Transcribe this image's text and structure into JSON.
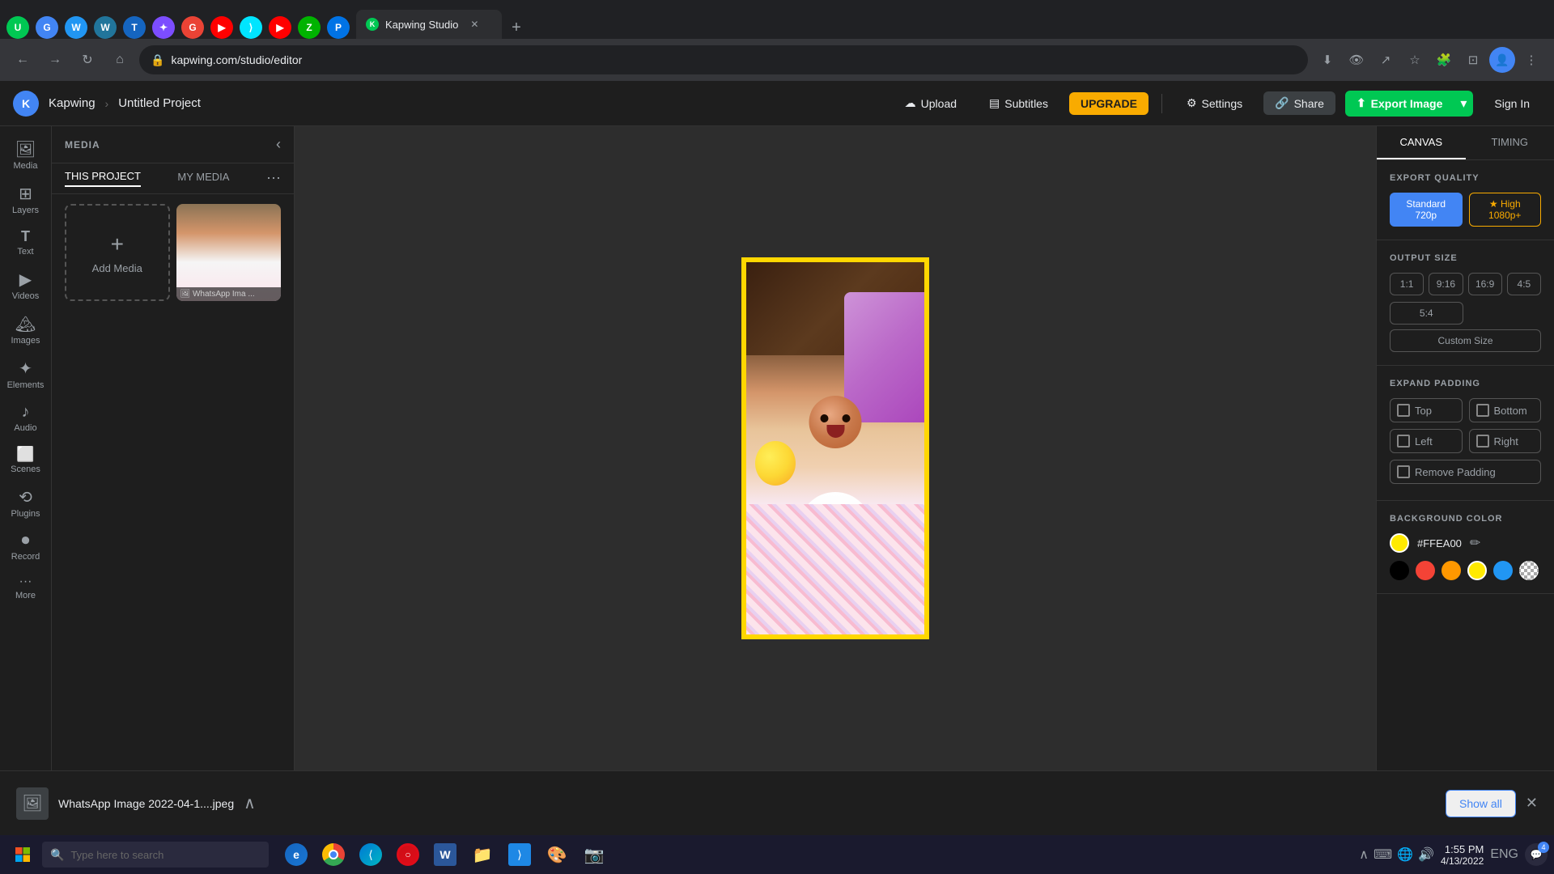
{
  "browser": {
    "tabs": [
      {
        "id": "tab-active",
        "label": "Kapwing Studio",
        "active": true,
        "favicon": "K"
      },
      {
        "id": "tab-plus",
        "label": "+",
        "active": false
      }
    ],
    "address": "kapwing.com/studio/editor",
    "nav": {
      "back": "←",
      "forward": "→",
      "reload": "↻",
      "home": "⌂"
    }
  },
  "app": {
    "brand": "Kapwing",
    "breadcrumb_sep": "›",
    "project_name": "Untitled Project",
    "header": {
      "upload_label": "Upload",
      "subtitles_label": "Subtitles",
      "upgrade_label": "UPGRADE",
      "settings_label": "Settings",
      "share_label": "Share",
      "export_label": "Export Image",
      "signin_label": "Sign In"
    }
  },
  "sidebar": {
    "items": [
      {
        "id": "media",
        "label": "Media",
        "icon": "🖼"
      },
      {
        "id": "layers",
        "label": "Layers",
        "icon": "⊞"
      },
      {
        "id": "text",
        "label": "Text",
        "icon": "T"
      },
      {
        "id": "videos",
        "label": "Videos",
        "icon": "▶"
      },
      {
        "id": "images",
        "label": "Images",
        "icon": "🏔"
      },
      {
        "id": "elements",
        "label": "Elements",
        "icon": "✦"
      },
      {
        "id": "audio",
        "label": "Audio",
        "icon": "♪"
      },
      {
        "id": "scenes",
        "label": "Scenes",
        "icon": "⬜"
      },
      {
        "id": "plugins",
        "label": "Plugins",
        "icon": "⟲"
      },
      {
        "id": "record",
        "label": "Record",
        "icon": "⏺"
      },
      {
        "id": "more",
        "label": "More",
        "icon": "···"
      }
    ]
  },
  "media_panel": {
    "title": "MEDIA",
    "tabs": [
      {
        "id": "this-project",
        "label": "THIS PROJECT",
        "active": true
      },
      {
        "id": "my-media",
        "label": "MY MEDIA",
        "active": false
      }
    ],
    "add_media_label": "Add Media",
    "thumbnail": {
      "name": "WhatsApp Ima ..."
    }
  },
  "right_panel": {
    "tabs": [
      {
        "id": "canvas",
        "label": "CANVAS",
        "active": true
      },
      {
        "id": "timing",
        "label": "TIMING",
        "active": false
      }
    ],
    "export_quality": {
      "title": "EXPORT QUALITY",
      "standard_label": "Standard 720p",
      "high_label": "★ High 1080p+"
    },
    "output_size": {
      "title": "OUTPUT SIZE",
      "buttons": [
        "1:1",
        "9:16",
        "16:9",
        "4:5",
        "5:4"
      ],
      "custom_label": "Custom Size"
    },
    "expand_padding": {
      "title": "EXPAND PADDING",
      "buttons": [
        {
          "id": "top",
          "label": "Top"
        },
        {
          "id": "bottom",
          "label": "Bottom"
        },
        {
          "id": "left",
          "label": "Left"
        },
        {
          "id": "right",
          "label": "Right"
        }
      ],
      "remove_label": "Remove Padding"
    },
    "background_color": {
      "title": "BACKGROUND COLOR",
      "hex": "#FFEA00",
      "swatches": [
        {
          "id": "black",
          "color": "#000000"
        },
        {
          "id": "red",
          "color": "#f44336"
        },
        {
          "id": "orange",
          "color": "#ff9800"
        },
        {
          "id": "yellow",
          "color": "#FFEA00"
        },
        {
          "id": "blue",
          "color": "#2196f3"
        },
        {
          "id": "transparent",
          "color": "transparent",
          "pattern": true
        }
      ]
    }
  },
  "bottom_bar": {
    "file_name": "WhatsApp Image 2022-04-1....jpeg",
    "show_all_label": "Show all"
  },
  "taskbar": {
    "search_placeholder": "Type here to search",
    "time": "1:55 PM",
    "date": "4/13/2022",
    "notification_count": "4",
    "lang": "ENG"
  }
}
